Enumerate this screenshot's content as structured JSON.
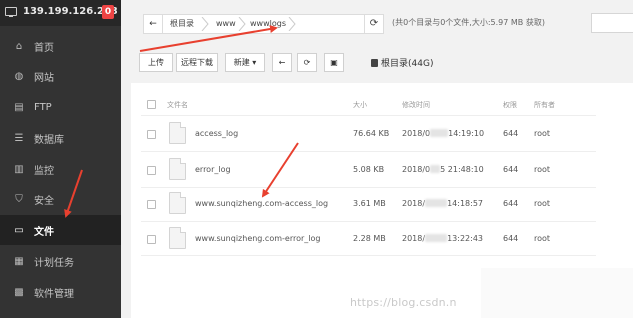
{
  "server": {
    "ip": "139.199.126.223",
    "badge": "0"
  },
  "sidebar": {
    "items": [
      {
        "label": "首页",
        "icon": "home-icon",
        "glyph": "⌂"
      },
      {
        "label": "网站",
        "icon": "globe-icon",
        "glyph": "◍"
      },
      {
        "label": "FTP",
        "icon": "ftp-icon",
        "glyph": "▤"
      },
      {
        "label": "数据库",
        "icon": "database-icon",
        "glyph": "☰"
      },
      {
        "label": "监控",
        "icon": "monitor-icon",
        "glyph": "▥"
      },
      {
        "label": "安全",
        "icon": "shield-icon",
        "glyph": "⛉"
      },
      {
        "label": "文件",
        "icon": "folder-icon",
        "glyph": "▭",
        "active": true
      },
      {
        "label": "计划任务",
        "icon": "calendar-icon",
        "glyph": "▦"
      },
      {
        "label": "软件管理",
        "icon": "grid-icon",
        "glyph": "▩"
      }
    ]
  },
  "breadcrumb": {
    "back_glyph": "←",
    "segments": [
      "根目录",
      "www",
      "wwwlogs"
    ],
    "refresh_glyph": "⟳"
  },
  "summary": "(共0个目录与0个文件,大小:5.97 MB 获取)",
  "toolbar": {
    "upload": "上传",
    "remote_download": "远程下载",
    "new": "新建 ▾",
    "back_glyph": "←",
    "refresh_glyph": "⟳",
    "terminal_glyph": "▣",
    "disk_label": "根目录(44G)"
  },
  "table": {
    "headers": {
      "name": "文件名",
      "size": "大小",
      "modified": "修改时间",
      "perms": "权限",
      "owner": "所有者"
    },
    "rows": [
      {
        "name": "access_log",
        "size": "76.64 KB",
        "date_a": "2018/0",
        "date_b": "14:19:10",
        "perms": "644",
        "owner": "root"
      },
      {
        "name": "error_log",
        "size": "5.08 KB",
        "date_a": "2018/0",
        "date_b": "5 21:48:10",
        "perms": "644",
        "owner": "root"
      },
      {
        "name": "www.sunqizheng.com-access_log",
        "size": "3.61 MB",
        "date_a": "2018/",
        "date_b": "14:18:57",
        "perms": "644",
        "owner": "root"
      },
      {
        "name": "www.sunqizheng.com-error_log",
        "size": "2.28 MB",
        "date_a": "2018/",
        "date_b": "13:22:43",
        "perms": "644",
        "owner": "root"
      }
    ]
  },
  "watermark": "https://blog.csdn.n",
  "colors": {
    "sidebar_bg": "#333333",
    "annotation_red": "#e8402f",
    "badge_red": "#ee4444"
  }
}
